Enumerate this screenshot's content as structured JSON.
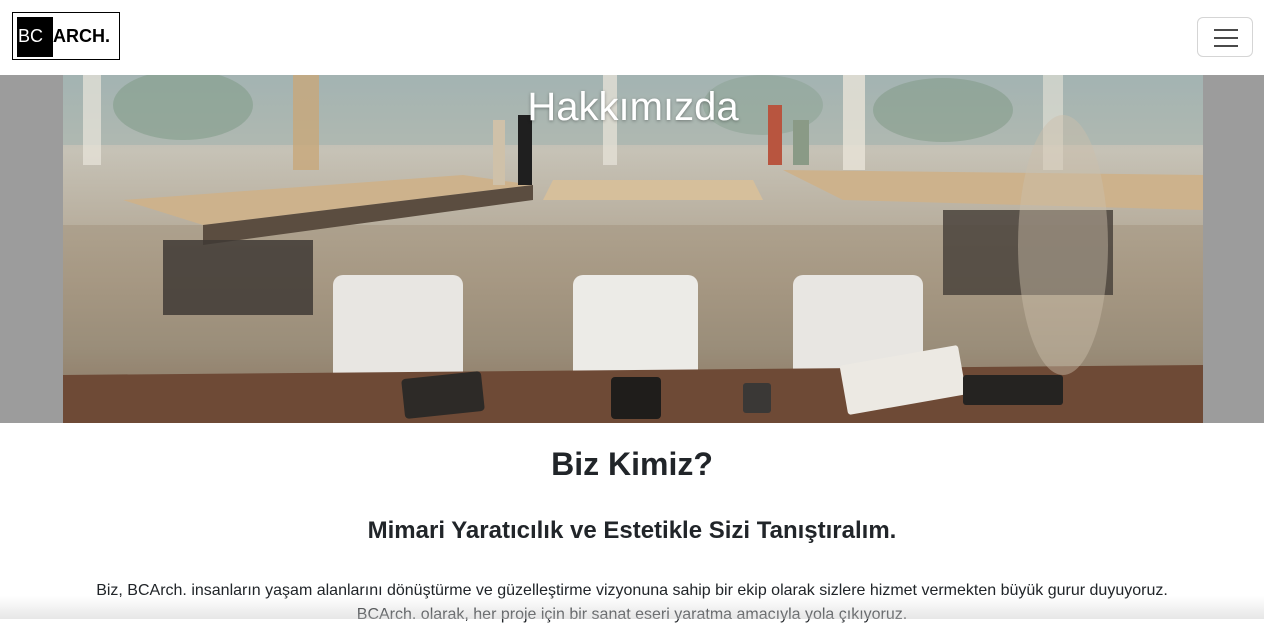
{
  "navbar": {
    "logo": {
      "part1": "BC",
      "part2": "ARCH."
    },
    "menu_icon": "hamburger-icon"
  },
  "hero": {
    "title": "Hakkımızda",
    "image_description_icon": "office-photo"
  },
  "about": {
    "title": "Biz Kimiz?",
    "subtitle": "Mimari Yaratıcılık ve Estetikle Sizi Tanıştıralım.",
    "paragraph_line1": "Biz, BCArch. insanların yaşam alanlarını dönüştürme ve güzelleştirme vizyonuna sahip bir ekip olarak sizlere hizmet vermekten büyük gurur duyuyoruz.",
    "paragraph_line2": "BCArch. olarak, her proje için bir sanat eseri yaratma amacıyla yola çıkıyoruz."
  },
  "colors": {
    "hero_backdrop": "#9c9c9c",
    "text": "#212529",
    "logo_black": "#000000"
  }
}
